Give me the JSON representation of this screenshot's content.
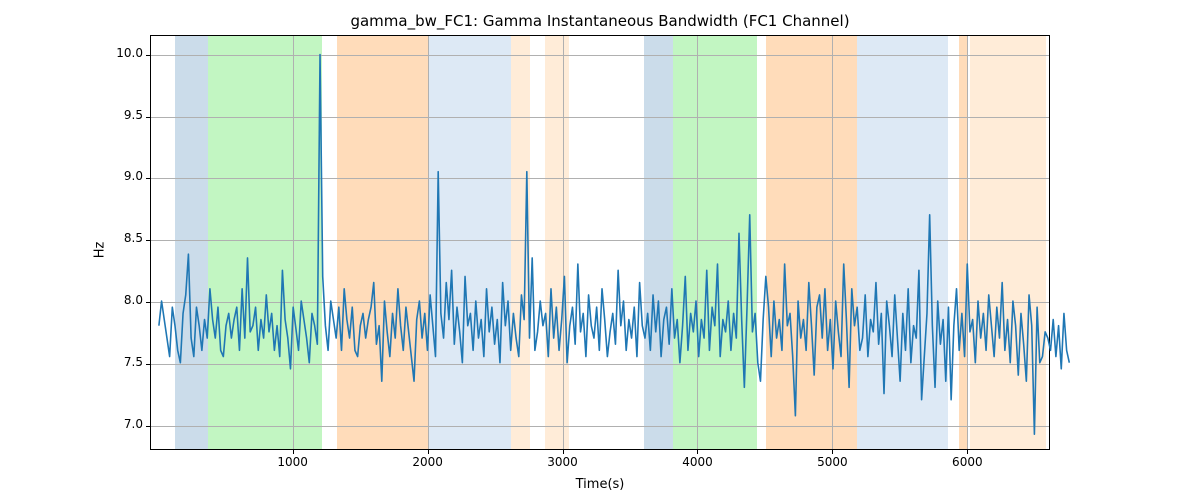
{
  "chart_data": {
    "type": "line",
    "title": "gamma_bw_FC1: Gamma Instantaneous Bandwidth (FC1 Channel)",
    "xlabel": "Time(s)",
    "ylabel": "Hz",
    "xlim": [
      -50,
      6620
    ],
    "ylim": [
      6.8,
      10.15
    ],
    "xticks": [
      1000,
      2000,
      3000,
      4000,
      5000,
      6000
    ],
    "yticks": [
      7.0,
      7.5,
      8.0,
      8.5,
      9.0,
      9.5,
      10.0
    ],
    "regions": [
      {
        "x0": 130,
        "x1": 370,
        "color": "blue"
      },
      {
        "x0": 370,
        "x1": 1220,
        "color": "green"
      },
      {
        "x0": 1330,
        "x1": 2000,
        "color": "orange"
      },
      {
        "x0": 2000,
        "x1": 2620,
        "color": "lblue"
      },
      {
        "x0": 2620,
        "x1": 2760,
        "color": "peach"
      },
      {
        "x0": 2870,
        "x1": 3050,
        "color": "peach"
      },
      {
        "x0": 3600,
        "x1": 3820,
        "color": "blue"
      },
      {
        "x0": 3820,
        "x1": 4440,
        "color": "green"
      },
      {
        "x0": 4510,
        "x1": 5180,
        "color": "orange"
      },
      {
        "x0": 5180,
        "x1": 5860,
        "color": "lblue"
      },
      {
        "x0": 5940,
        "x1": 6000,
        "color": "orange"
      },
      {
        "x0": 6020,
        "x1": 6580,
        "color": "peach"
      }
    ],
    "series": [
      {
        "name": "gamma_bw_FC1",
        "x_start": 0,
        "x_step": 20,
        "values": [
          7.8,
          8.0,
          7.85,
          7.7,
          7.55,
          7.95,
          7.8,
          7.6,
          7.5,
          7.9,
          8.05,
          8.38,
          7.7,
          7.55,
          7.95,
          7.8,
          7.6,
          7.85,
          7.7,
          8.1,
          7.85,
          7.7,
          7.95,
          7.6,
          7.55,
          7.8,
          7.9,
          7.7,
          7.85,
          7.95,
          7.6,
          8.1,
          7.7,
          8.35,
          7.75,
          7.8,
          7.95,
          7.6,
          7.85,
          7.7,
          8.05,
          7.75,
          7.9,
          7.6,
          7.8,
          7.55,
          8.25,
          7.85,
          7.7,
          7.45,
          7.95,
          7.78,
          7.6,
          8.0,
          7.85,
          7.7,
          7.5,
          7.9,
          7.8,
          7.65,
          10.0,
          8.2,
          7.8,
          7.6,
          8.0,
          7.85,
          7.7,
          7.95,
          7.6,
          8.1,
          7.85,
          7.7,
          7.95,
          7.6,
          7.55,
          7.8,
          7.9,
          7.7,
          7.85,
          7.95,
          8.15,
          7.65,
          7.8,
          7.35,
          8.0,
          7.75,
          7.55,
          7.9,
          7.7,
          8.1,
          7.8,
          7.6,
          7.95,
          7.75,
          7.55,
          7.35,
          7.85,
          8.0,
          7.7,
          7.9,
          7.6,
          8.05,
          7.8,
          7.55,
          9.05,
          7.9,
          7.7,
          8.15,
          7.85,
          8.25,
          7.65,
          7.95,
          7.75,
          7.5,
          8.2,
          7.8,
          7.9,
          7.6,
          8.0,
          7.7,
          7.85,
          7.55,
          8.1,
          7.75,
          7.95,
          7.65,
          7.85,
          7.5,
          8.15,
          7.8,
          8.0,
          7.6,
          7.9,
          7.7,
          7.55,
          8.05,
          7.85,
          9.05,
          7.7,
          8.35,
          7.6,
          7.75,
          8.0,
          7.8,
          7.9,
          7.55,
          8.1,
          7.7,
          7.95,
          7.6,
          7.85,
          8.2,
          7.5,
          7.8,
          7.95,
          7.65,
          8.3,
          7.75,
          7.9,
          7.55,
          8.05,
          7.8,
          7.7,
          7.95,
          7.6,
          8.1,
          7.85,
          7.55,
          7.75,
          7.9,
          7.65,
          8.25,
          7.8,
          8.0,
          7.6,
          7.85,
          7.7,
          7.95,
          7.55,
          8.15,
          7.8,
          7.7,
          7.9,
          7.6,
          8.05,
          7.75,
          8.0,
          7.55,
          7.85,
          7.95,
          7.65,
          8.1,
          7.7,
          7.85,
          7.5,
          7.8,
          8.2,
          7.6,
          7.9,
          7.75,
          8.0,
          7.55,
          7.85,
          7.7,
          8.25,
          7.6,
          7.95,
          7.8,
          8.3,
          7.55,
          7.85,
          7.75,
          8.0,
          7.6,
          7.9,
          7.7,
          8.55,
          7.85,
          7.3,
          7.95,
          8.7,
          7.75,
          7.9,
          7.5,
          7.35,
          7.85,
          8.2,
          7.95,
          7.55,
          8.0,
          7.7,
          7.85,
          7.6,
          8.3,
          7.8,
          7.9,
          7.55,
          7.07,
          8.0,
          7.7,
          7.85,
          7.6,
          8.15,
          7.8,
          7.4,
          7.95,
          8.05,
          7.7,
          8.1,
          7.6,
          7.85,
          7.45,
          8.0,
          7.75,
          7.55,
          8.3,
          7.85,
          7.3,
          8.1,
          7.8,
          7.95,
          7.6,
          7.7,
          8.05,
          7.55,
          7.85,
          7.75,
          8.15,
          7.65,
          7.9,
          7.25,
          8.0,
          7.8,
          7.55,
          8.05,
          7.7,
          7.35,
          7.9,
          7.6,
          8.1,
          7.5,
          7.8,
          7.7,
          8.25,
          7.2,
          7.55,
          7.9,
          8.7,
          7.8,
          7.3,
          8.0,
          7.65,
          7.85,
          7.35,
          7.95,
          7.2,
          7.8,
          8.1,
          7.6,
          7.9,
          7.55,
          8.3,
          7.75,
          7.85,
          7.5,
          8.0,
          7.7,
          7.9,
          7.6,
          8.05,
          7.8,
          7.55,
          7.95,
          7.7,
          8.15,
          7.6,
          7.85,
          7.5,
          8.0,
          7.8,
          7.4,
          7.9,
          7.65,
          7.35,
          8.05,
          7.8,
          6.92,
          7.95,
          7.5,
          7.55,
          7.75,
          7.7,
          7.6,
          7.85,
          7.55,
          7.8,
          7.45,
          7.9,
          7.6,
          7.5
        ]
      }
    ]
  }
}
